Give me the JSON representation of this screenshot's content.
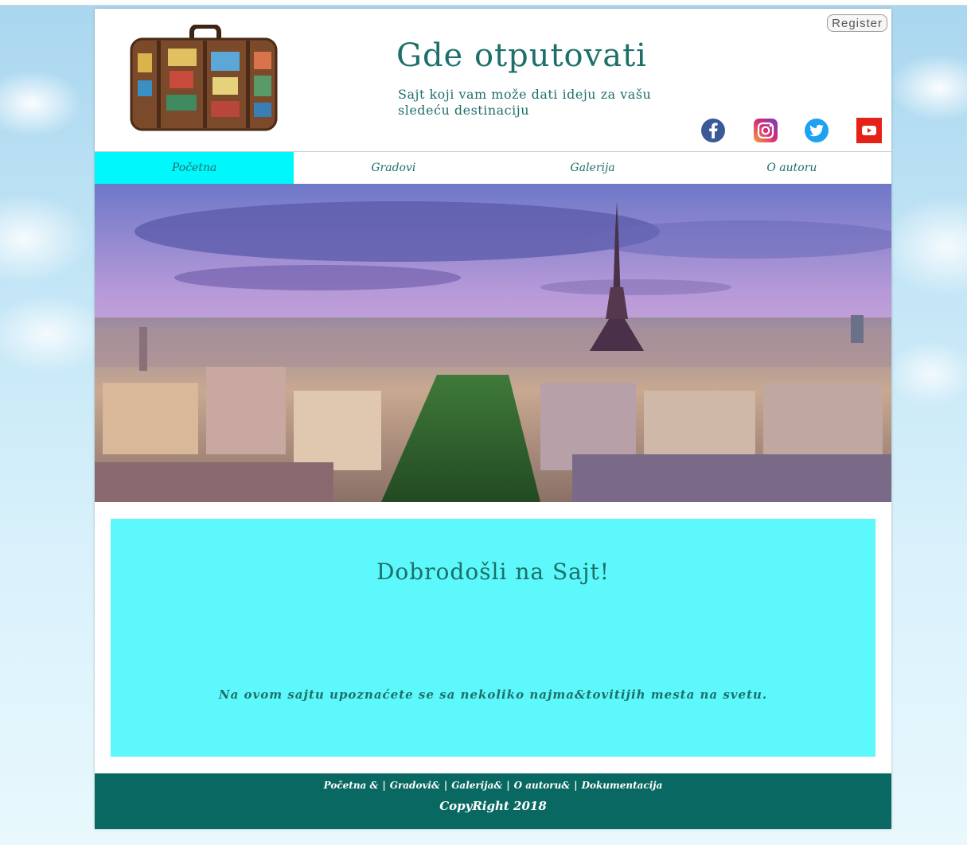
{
  "header": {
    "register_label": "Register",
    "title": "Gde otputovati",
    "subtitle": "Sajt koji vam može dati ideju za vašu sledeću destinaciju"
  },
  "social": [
    {
      "icon": "facebook-icon",
      "color": "#3b5998"
    },
    {
      "icon": "instagram-icon",
      "color": "#c13584"
    },
    {
      "icon": "twitter-icon",
      "color": "#1da1f2"
    },
    {
      "icon": "youtube-icon",
      "color": "#e62117"
    }
  ],
  "nav": {
    "items": [
      {
        "label": "Početna",
        "active": true
      },
      {
        "label": "Gradovi",
        "active": false
      },
      {
        "label": "Galerija",
        "active": false
      },
      {
        "label": "O autoru",
        "active": false
      }
    ]
  },
  "hero": {
    "image": "paris-eiffel-tower-photo"
  },
  "welcome": {
    "title": "Dobrodošli na Sajt!",
    "text": "Na ovom sajtu upoznaćete se sa nekoliko najma&tovitijih mesta na svetu."
  },
  "footer": {
    "links": [
      {
        "label": "Početna &"
      },
      {
        "label": "Gradovi&"
      },
      {
        "label": "Galerija&"
      },
      {
        "label": "O autoru&"
      },
      {
        "label": "Dokumentacija"
      }
    ],
    "separator": "|",
    "copyright": "CopyRight 2018"
  },
  "colors": {
    "accent": "#00f7fb",
    "welcome_bg": "#5cf8fb",
    "text": "#1d6f6a",
    "footer_bg": "#0a6862"
  }
}
